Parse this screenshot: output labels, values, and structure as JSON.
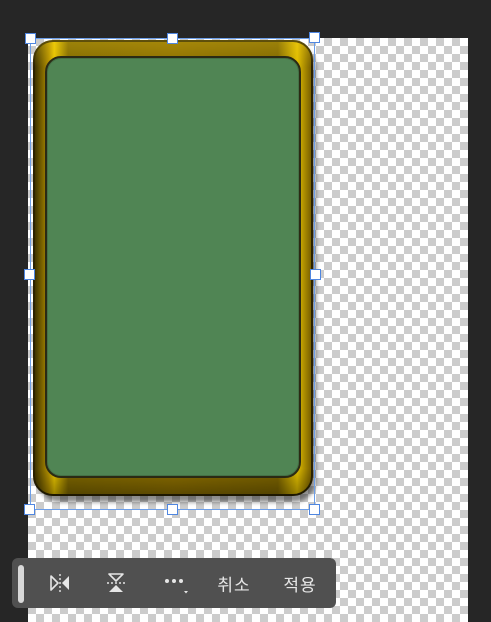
{
  "editor": {
    "canvas": "transparent-checkerboard",
    "shape": {
      "frame_color": "#8a6d00",
      "frame_highlight": "#e7c400",
      "panel_color": "#508554"
    },
    "selection_color": "#4f86e0"
  },
  "toolbar": {
    "background": "#505050",
    "buttons": [
      {
        "icon": "flip-horizontal-icon"
      },
      {
        "icon": "flip-vertical-icon"
      },
      {
        "icon": "more-options-icon"
      }
    ],
    "cancel_label": "취소",
    "apply_label": "적용"
  }
}
